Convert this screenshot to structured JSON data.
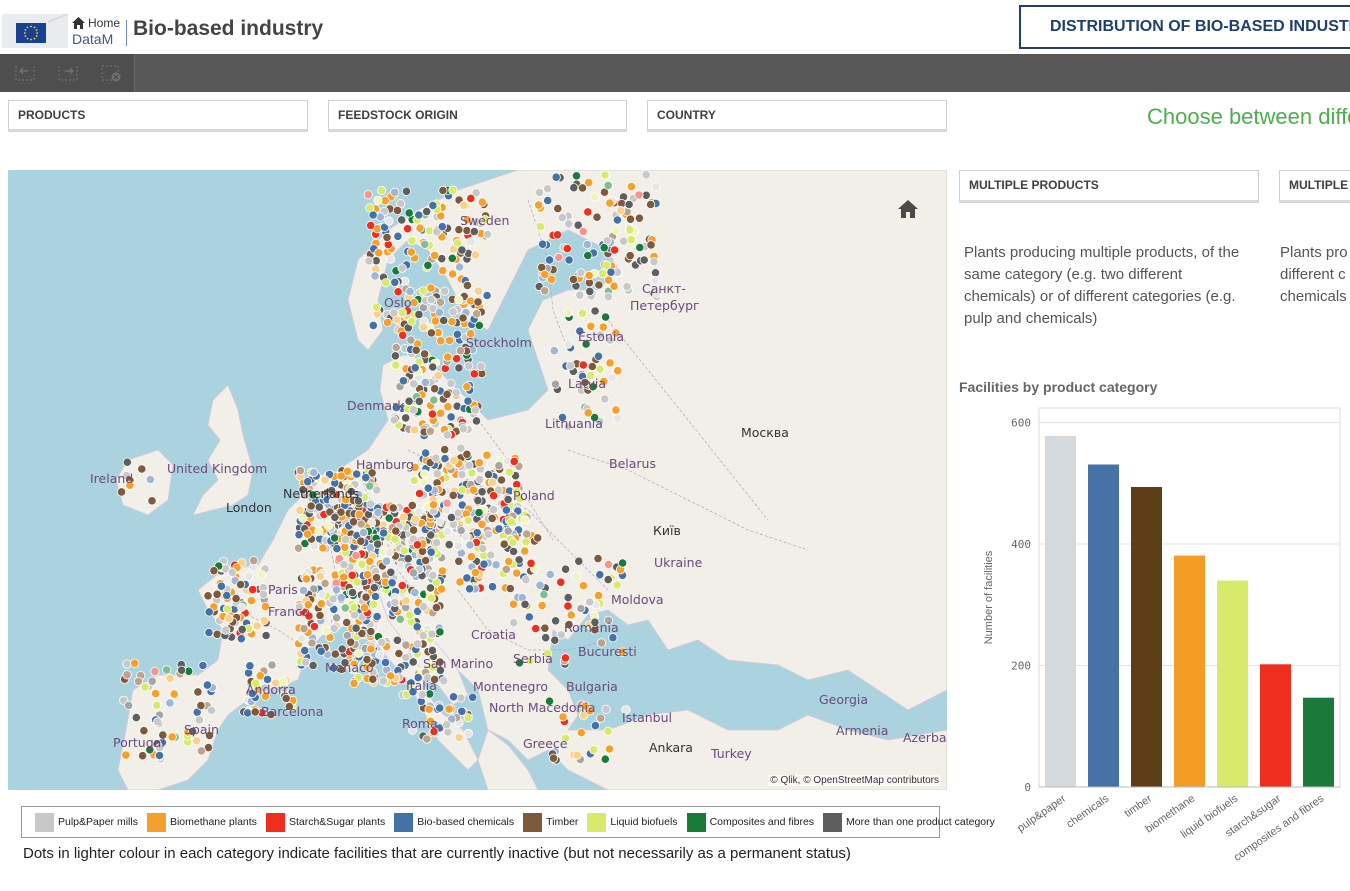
{
  "header": {
    "home_label": "Home",
    "brand": "DataM",
    "app_title": "Bio-based industry",
    "sheet_title": "DISTRIBUTION OF BIO-BASED INDUSTRY"
  },
  "filters": [
    {
      "label": "PRODUCTS"
    },
    {
      "label": "FEEDSTOCK ORIGIN"
    },
    {
      "label": "COUNTRY"
    }
  ],
  "green_banner": "Choose between different",
  "map": {
    "attribution": "© Qlik, © OpenStreetMap contributors",
    "labels": [
      "Sweden",
      "Oslo",
      "Stockholm",
      "Санкт-",
      "Петербург",
      "Estonia",
      "Latvia",
      "Lithuania",
      "Denmark",
      "Москва",
      "Belarus",
      "Ireland",
      "United Kingdom",
      "London",
      "Netherlands",
      "Poland",
      "Київ",
      "Ukraine",
      "Paris",
      "France",
      "Moldova",
      "Romania",
      "Serbia",
      "Bucuresti",
      "Monaco",
      "San Marino",
      "Montenegro",
      "Bulgaria",
      "Italia",
      "Andorra",
      "Barcelona",
      "Spain",
      "Portugal",
      "Roma",
      "North Macedonia",
      "Greece",
      "Istanbul",
      "Ankara",
      "Turkey",
      "Georgia",
      "Armenia",
      "Azerbaijan",
      "Croatia",
      "Hamburg"
    ],
    "categories": [
      {
        "name": "Pulp&Paper mills",
        "color": "#c8c8c8",
        "light": "#e6e6e6"
      },
      {
        "name": "Biomethane plants",
        "color": "#f5a02a",
        "light": "#fad08a"
      },
      {
        "name": "Starch&Sugar plants",
        "color": "#ee2f1f",
        "light": "#f7958c"
      },
      {
        "name": "Bio-based chemicals",
        "color": "#4472a8",
        "light": "#9db6d6"
      },
      {
        "name": "Timber",
        "color": "#7d5a3c",
        "light": "#bda38c"
      },
      {
        "name": "Liquid biofuels",
        "color": "#d8ea6c",
        "light": "#eef6bd"
      },
      {
        "name": "Composites and fibres",
        "color": "#1a7a3a",
        "light": "#7fbe91"
      },
      {
        "name": "More than one product category",
        "color": "#5e5e5e",
        "light": "#a5a5a5"
      }
    ]
  },
  "note": "Dots in lighter colour in each category indicate facilities that are currently inactive (but not necessarily as a permanent status)",
  "info": [
    {
      "label": "MULTIPLE PRODUCTS",
      "desc": [
        "Plants producing multiple products, of the",
        "same category (e.g. two different",
        "chemicals) or of different categories (e.g.",
        "pulp and chemicals)"
      ]
    },
    {
      "label": "MULTIPLE",
      "desc": [
        "Plants pro",
        "different c",
        "chemicals"
      ]
    }
  ],
  "chart_data": {
    "type": "bar",
    "title": "Facilities by product category",
    "xlabel": "",
    "ylabel": "Number of facilities",
    "categories": [
      "pulp&paper",
      "chemicals",
      "timber",
      "biomethane",
      "liquid biofuels",
      "starch&sugar",
      "composites and fibres"
    ],
    "values": [
      578,
      531,
      494,
      381,
      340,
      202,
      147
    ],
    "colors": [
      "#d3d9dd",
      "#4672a6",
      "#5e3e17",
      "#f49d26",
      "#d8ea6c",
      "#ee2f1f",
      "#1a7a3a"
    ],
    "yticks": [
      0,
      200,
      400,
      600
    ],
    "ylim": [
      0,
      600
    ],
    "grid": true
  }
}
